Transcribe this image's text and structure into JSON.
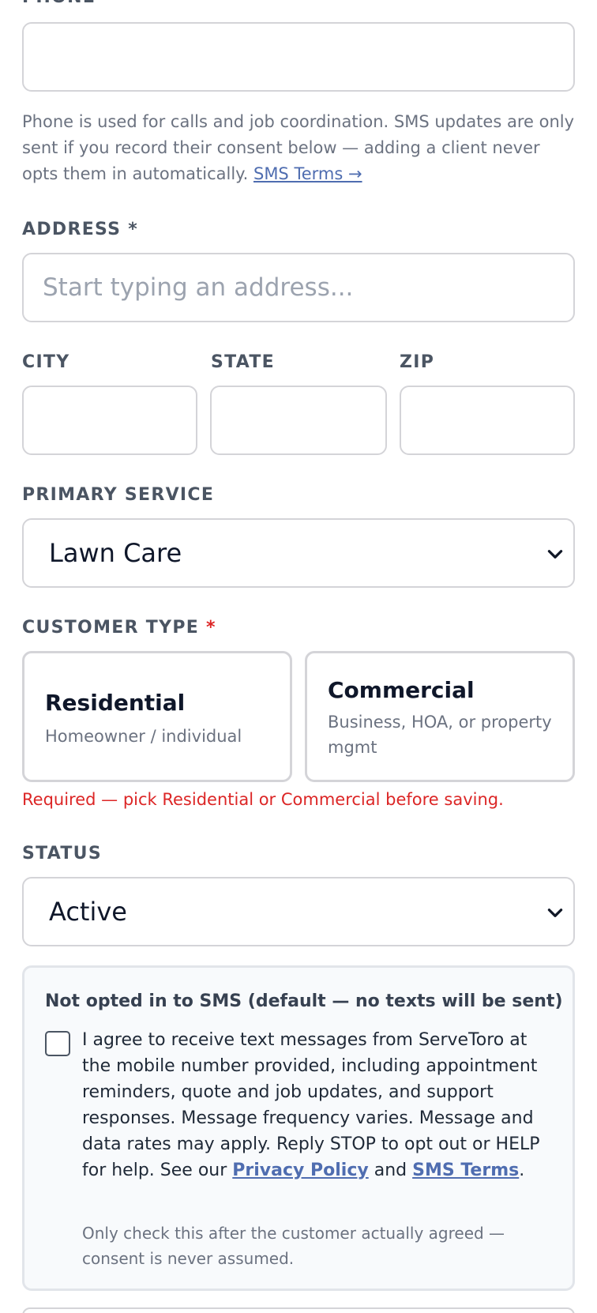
{
  "phone": {
    "label": "PHONE",
    "required_mark": "*",
    "value": "",
    "placeholder": "",
    "help_text": "Phone is used for calls and job coordination. SMS updates are only sent if you record their consent below — adding a client never opts them in automatically.",
    "help_link": "SMS Terms →"
  },
  "address": {
    "label": "ADDRESS",
    "required_mark": "*",
    "value": "",
    "placeholder": "Start typing an address..."
  },
  "city": {
    "label": "CITY",
    "value": ""
  },
  "state": {
    "label": "STATE",
    "value": ""
  },
  "zip": {
    "label": "ZIP",
    "value": ""
  },
  "primary_service": {
    "label": "PRIMARY SERVICE",
    "selected": "Lawn Care"
  },
  "customer_type": {
    "label": "CUSTOMER TYPE",
    "required_mark": "*",
    "options": [
      {
        "title": "Residential",
        "subtitle": "Homeowner / individual"
      },
      {
        "title": "Commercial",
        "subtitle": "Business, HOA, or property mgmt"
      }
    ],
    "error": "Required — pick Residential or Commercial before saving."
  },
  "status": {
    "label": "STATUS",
    "selected": "Active"
  },
  "sms": {
    "title": "Not opted in to SMS (default — no texts will be sent)",
    "checked": false,
    "consent_text": "I agree to receive text messages from ServeToro at the mobile number provided, including appointment reminders, quote and job updates, and support responses. Message frequency varies. Message and data rates may apply. Reply STOP to opt out or HELP for help. See our",
    "privacy_link": "Privacy Policy",
    "and_text": "and",
    "terms_link": "SMS Terms",
    "period": ".",
    "note": "Only check this after the customer actually agreed — consent is never assumed."
  },
  "colors": {
    "accent_link": "#4f6db0",
    "error": "#dc2626",
    "border": "#d4d4d8"
  }
}
